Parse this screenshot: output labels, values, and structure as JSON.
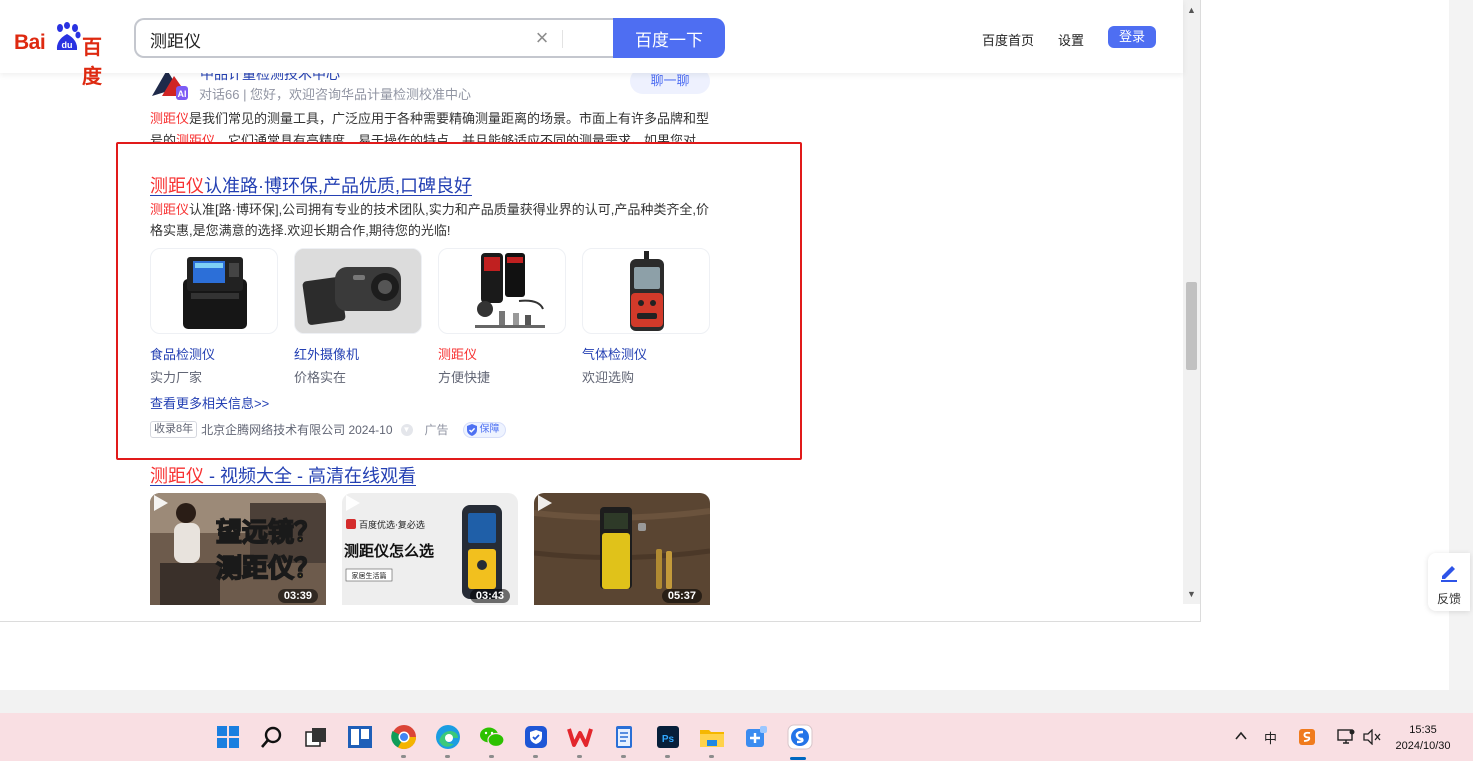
{
  "header": {
    "logo_text_bai": "Bai",
    "logo_text_du": "du",
    "logo_text_cn": "百度",
    "search_value": "测距仪",
    "search_button": "百度一下",
    "links": [
      "百度首页",
      "设置"
    ],
    "login": "登录"
  },
  "prev_result": {
    "title_partial": "中品计量检测技术中心",
    "meta": "对话66 | 您好，欢迎咨询华品计量检测校准中心",
    "chat_button": "聊一聊",
    "desc_hl1": "测距仪",
    "desc_part1": "是我们常见的测量工具，广泛应用于各种需要精确测量距离的场景。市面上有许多品牌和型号的",
    "desc_hl2": "测距仪",
    "desc_part2": "，它们通常具有高精度、易于操作的特点，并且能够适应不同的测量需求。如果您对"
  },
  "ad": {
    "title_hl": "测距仪",
    "title_rest": "认准路·博环保,产品优质,口碑良好",
    "desc_hl": "测距仪",
    "desc_rest": "认准[路·博环保],公司拥有专业的技术团队,实力和产品质量获得业界的认可,产品种类齐全,价格实惠,是您满意的选择.欢迎长期合作,期待您的光临!",
    "products": [
      {
        "name": "食品检测仪",
        "sub": "实力厂家"
      },
      {
        "name": "红外摄像机",
        "sub": "价格实在"
      },
      {
        "name": "测距仪",
        "sub": "方便快捷"
      },
      {
        "name": "气体检测仪",
        "sub": "欢迎选购"
      }
    ],
    "more": "查看更多相关信息>>",
    "years": "收录8年",
    "company": "北京企腾网络技术有限公司 2024-10",
    "ad_label": "广告",
    "badge": "保障"
  },
  "video": {
    "title_hl": "测距仪",
    "title_rest": " - 视频大全 - 高清在线观看",
    "cards": [
      {
        "overlay": "望远镜？测距仪？",
        "duration": "03:39"
      },
      {
        "brand": "百度优选·复必选",
        "overlay": "测距仪怎么选",
        "tag": "家居生活篇",
        "duration": "03:43"
      },
      {
        "duration": "05:37"
      }
    ]
  },
  "scroll": {
    "up": "▲",
    "down": "▼"
  },
  "feedback": "反馈",
  "taskbar": {
    "icons": [
      "windows-start",
      "search",
      "task-view",
      "widgets",
      "chrome",
      "edge",
      "wechat",
      "security",
      "wps",
      "notepad",
      "photoshop",
      "file-explorer",
      "snipping",
      "sogou-browser"
    ],
    "tray_ime": "中",
    "time": "15:35",
    "date": "2024/10/30"
  },
  "colors": {
    "accent": "#4e6ef2",
    "link": "#2440b3",
    "highlight": "#f73131",
    "annotation_box": "#e11a1a"
  }
}
